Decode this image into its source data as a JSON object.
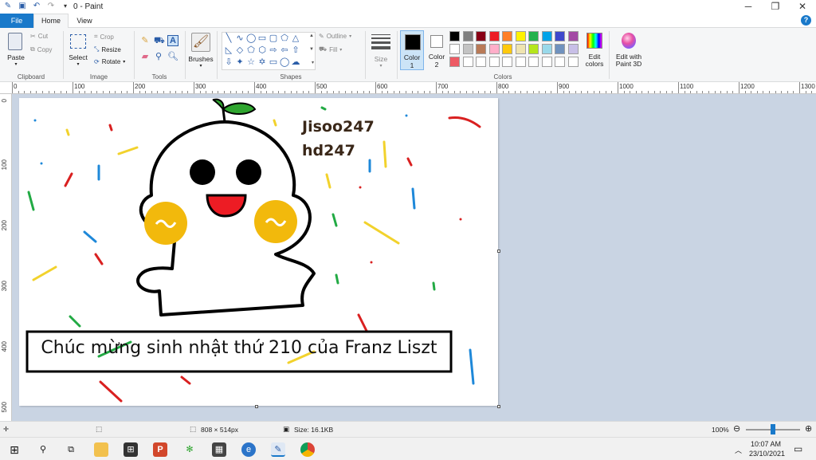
{
  "window": {
    "title": "0 - Paint"
  },
  "tabs": [
    {
      "label": "File"
    },
    {
      "label": "Home"
    },
    {
      "label": "View"
    }
  ],
  "ribbon": {
    "clipboard": {
      "group": "Clipboard",
      "paste": "Paste",
      "cut": "Cut",
      "copy": "Copy"
    },
    "image": {
      "group": "Image",
      "select": "Select",
      "crop": "Crop",
      "resize": "Resize",
      "rotate": "Rotate"
    },
    "tools": {
      "group": "Tools"
    },
    "brushes": {
      "label": "Brushes"
    },
    "shapes": {
      "group": "Shapes",
      "outline": "Outline",
      "fill": "Fill"
    },
    "size": {
      "label": "Size"
    },
    "colors": {
      "group": "Colors",
      "color1": "Color",
      "color1_num": "1",
      "color2": "Color",
      "color2_num": "2",
      "edit_colors": "Edit colors",
      "edit_paint3d": "Edit with Paint 3D",
      "palette_row1": [
        "#000000",
        "#7f7f7f",
        "#880015",
        "#ed1c24",
        "#ff7f27",
        "#fff200",
        "#22b14c",
        "#00a2e8",
        "#3f48cc",
        "#a349a4"
      ],
      "palette_row2": [
        "#ffffff",
        "#c3c3c3",
        "#b97a57",
        "#ffaec9",
        "#ffc90e",
        "#efe4b0",
        "#b5e61d",
        "#99d9ea",
        "#7092be",
        "#c8bfe7"
      ],
      "palette_row3": [
        "#ed5a64",
        "#ffffff",
        "#ffffff",
        "#ffffff",
        "#ffffff",
        "#ffffff",
        "#ffffff",
        "#ffffff",
        "#ffffff",
        "#ffffff"
      ]
    }
  },
  "ruler": {
    "top": [
      "0",
      "100",
      "200",
      "300",
      "400",
      "500",
      "600",
      "700",
      "800",
      "900",
      "1000",
      "1100",
      "1200",
      "1300"
    ],
    "left": [
      "0",
      "100",
      "200",
      "300",
      "400",
      "500"
    ]
  },
  "canvas": {
    "signature_line1": "Jisoo247",
    "signature_line2": "hd247",
    "banner": "Chúc mừng sinh nhật thứ 210 của Franz Liszt"
  },
  "status": {
    "dimensions": "808 × 514px",
    "size": "Size: 16.1KB",
    "zoom": "100%"
  },
  "taskbar": {
    "time": "10:07 AM",
    "date": "23/10/2021"
  }
}
